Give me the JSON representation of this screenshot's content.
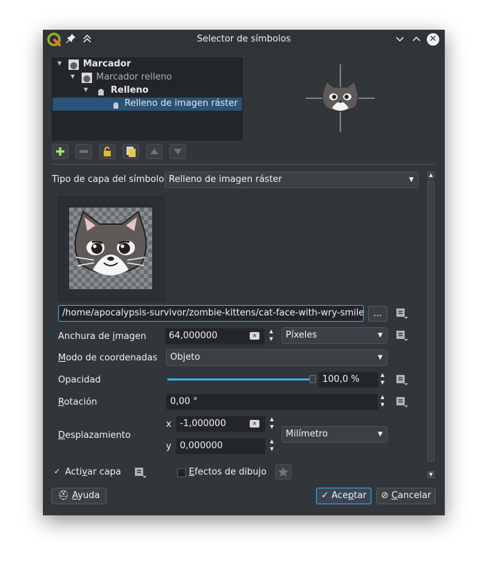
{
  "window": {
    "title": "Selector de símbolos"
  },
  "tree": {
    "items": [
      {
        "label": "Marcador",
        "bold": true
      },
      {
        "label": "Marcador relleno",
        "bold": false
      },
      {
        "label": "Relleno",
        "bold": true
      },
      {
        "label": "Relleno de imagen ráster",
        "bold": false,
        "selected": true
      }
    ]
  },
  "form": {
    "layer_type_label": "Tipo de capa del símbolo",
    "layer_type_value": "Relleno de imagen ráster",
    "image_path": "/home/apocalypsis-survivor/zombie-kittens/cat-face-with-wry-smile",
    "browse_label": "...",
    "width_label_pre": "Anchura de ",
    "width_label_key": "i",
    "width_label_post": "magen",
    "width_value": "64,000000",
    "width_unit": "Píxeles",
    "coord_label_key": "M",
    "coord_label_post": "odo de coordenadas",
    "coord_value": "Objeto",
    "opacity_label": "Opacidad",
    "opacity_value": "100,0 %",
    "opacity_level": 1.0,
    "rotation_label_key": "R",
    "rotation_label_post": "otación",
    "rotation_value": "0,00 °",
    "offset_label_key": "D",
    "offset_label_post": "esplazamiento",
    "offset_x_label": "x",
    "offset_x_value": "-1,000000",
    "offset_y_label": "y",
    "offset_y_value": "0,000000",
    "offset_unit": "Milímetro",
    "enable_layer_pre": "Acti",
    "enable_layer_key": "v",
    "enable_layer_post": "ar capa",
    "enable_layer_checked": true,
    "effects_key": "E",
    "effects_post": "fectos de dibujo",
    "effects_checked": false
  },
  "buttons": {
    "help_key": "A",
    "help_post": "yuda",
    "accept_pre": "Ace",
    "accept_key": "p",
    "accept_post": "tar",
    "cancel_key": "C",
    "cancel_post": "ancelar"
  },
  "colors": {
    "accent": "#3daee9",
    "selection": "#2a5377",
    "window_bg": "#31363b"
  },
  "icons": [
    "qgis-logo-icon",
    "pin-icon",
    "keep-above-icon",
    "minimize-icon",
    "maximize-icon",
    "close-icon",
    "add-layer-icon",
    "remove-layer-icon",
    "lock-icon",
    "duplicate-icon",
    "move-up-icon",
    "move-down-icon",
    "data-defined-icon",
    "clear-icon",
    "star-icon",
    "help-icon",
    "check-icon",
    "cancel-icon"
  ]
}
